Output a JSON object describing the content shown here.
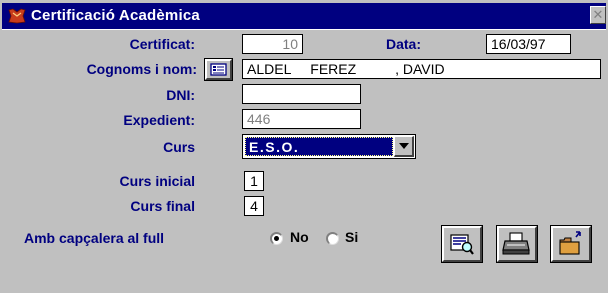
{
  "window": {
    "title": "Certificació Acadèmica",
    "close_glyph": "✕"
  },
  "form": {
    "certificat": {
      "label": "Certificat:",
      "value": "10"
    },
    "data": {
      "label": "Data:",
      "value": "16/03/97"
    },
    "cognoms": {
      "label": "Cognoms i nom:",
      "value": "ALDEL     FEREZ          , DAVID"
    },
    "dni": {
      "label": "DNI:",
      "value": ""
    },
    "expedient": {
      "label": "Expedient:",
      "value": "446"
    },
    "curs": {
      "label": "Curs",
      "value": "E.S.O."
    },
    "curs_inicial": {
      "label": "Curs inicial",
      "value": "1"
    },
    "curs_final": {
      "label": "Curs final",
      "value": "4"
    },
    "capcalera": {
      "label": "Amb capçalera al full",
      "options": [
        {
          "label": "No",
          "checked": true
        },
        {
          "label": "Si",
          "checked": false
        }
      ]
    }
  },
  "icons": {
    "lookup": "list-card-icon",
    "preview": "print-preview-icon",
    "print": "printer-icon",
    "exit": "exit-folder-icon"
  },
  "colors": {
    "titlebar": "#000080",
    "label": "#000080",
    "face": "#c0c0c0"
  }
}
